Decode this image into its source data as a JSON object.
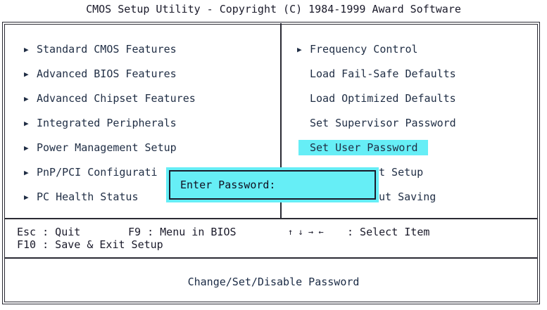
{
  "header": {
    "title": "CMOS Setup Utility - Copyright (C) 1984-1999 Award Software"
  },
  "left_menu": [
    "Standard CMOS Features",
    "Advanced BIOS Features",
    "Advanced Chipset Features",
    "Integrated Peripherals",
    "Power Management Setup",
    "PnP/PCI Configurati",
    "PC Health Status"
  ],
  "right_menu": [
    "Frequency Control",
    "Load Fail-Safe Defaults",
    "Load Optimized Defaults",
    "Set Supervisor Password",
    "Set User Password",
    "t Setup",
    "ut Saving"
  ],
  "dialog": {
    "prompt": "Enter Password:"
  },
  "help": {
    "esc": "Esc : Quit",
    "f9": "F9 : Menu in BIOS",
    "arrows": "↑ ↓ → ←",
    "select": ": Select Item",
    "f10": "F10 : Save & Exit Setup"
  },
  "status": {
    "text": "Change/Set/Disable Password"
  },
  "colors": {
    "highlight": "#66eef6",
    "text": "#1f2d44",
    "border": "#2a2a33"
  },
  "icons": {
    "submenu": "right-triangle-icon"
  }
}
